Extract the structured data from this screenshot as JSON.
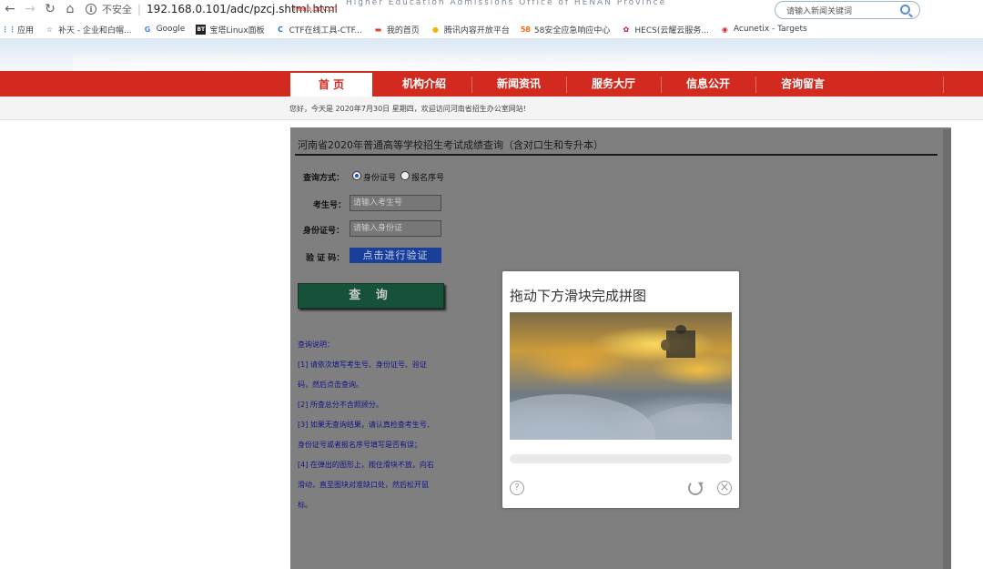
{
  "browser": {
    "insecure_label": "不安全",
    "url": "192.168.0.101/adc/pzcj.shtml.html",
    "bookmarks": [
      {
        "icon": "apps-icon",
        "label": "应用",
        "color": "#4285f4"
      },
      {
        "icon": "star-outline-icon",
        "label": "补天 - 企业和白帽...",
        "color": "#5f6368"
      },
      {
        "icon": "google-icon",
        "label": "Google",
        "color": "#4285f4"
      },
      {
        "icon": "bt-icon",
        "label": "宝塔Linux面板",
        "color": "#20a53a"
      },
      {
        "icon": "ctf-icon",
        "label": "CTF在线工具-CTF...",
        "color": "#1a73e8"
      },
      {
        "icon": "home-bookmark-icon",
        "label": "我的首页",
        "color": "#e33b2e"
      },
      {
        "icon": "tencent-icon",
        "label": "腾讯内容开放平台",
        "color": "#f4b400"
      },
      {
        "icon": "58-icon",
        "label": "58安全应急响应中心",
        "color": "#ff6a00"
      },
      {
        "icon": "huawei-icon",
        "label": "HECS(云耀云服务...",
        "color": "#cf0a2c"
      },
      {
        "icon": "acunetix-icon",
        "label": "Acunetix - Targets",
        "color": "#d32f2f"
      }
    ]
  },
  "site": {
    "domain": "heao.gov.cn",
    "english_name": "Higher Education Admissions Office of HENAN Province",
    "search_placeholder": "请输入新闻关键词",
    "nav": [
      "首 页",
      "机构介绍",
      "新闻资讯",
      "服务大厅",
      "信息公开",
      "咨询留言"
    ],
    "greeting": "您好，今天是 2020年7月30日 星期四，欢迎访问河南省招生办公室网站!"
  },
  "form": {
    "title": "河南省2020年普通高等学校招生考试成绩查询（含对口生和专升本）",
    "query_method_label": "查询方式：",
    "radio_id_label": "身份证号",
    "radio_reg_label": "报名序号",
    "exam_no_label": "考生号：",
    "exam_no_placeholder": "请输入考生号",
    "id_label": "身份证号：",
    "id_placeholder": "请输入身份证",
    "verify_label": "验 证 码：",
    "verify_button": "点击进行验证",
    "query_button": "查 询"
  },
  "notes": {
    "heading": "查询说明：",
    "lines": [
      "[1] 请依次填写考生号、身份证号、验证",
      "码，然后点击查询。",
      "[2] 所查总分不含照顾分。",
      "[3] 如果无查询结果，请认真检查考生号、",
      "身份证号或者报名序号填写是否有误；",
      "[4] 在弹出的图形上，按住滑块不放，向右",
      "滑动，直至图块对准缺口处，然后松开鼠",
      "标。"
    ]
  },
  "captcha": {
    "title": "拖动下方滑块完成拼图",
    "help_symbol": "?",
    "close_symbol": "×"
  },
  "colors": {
    "nav_red": "#d22a1e",
    "verify_blue": "#1a3f98",
    "query_green": "#16523a",
    "notes_blue": "#13138a"
  }
}
